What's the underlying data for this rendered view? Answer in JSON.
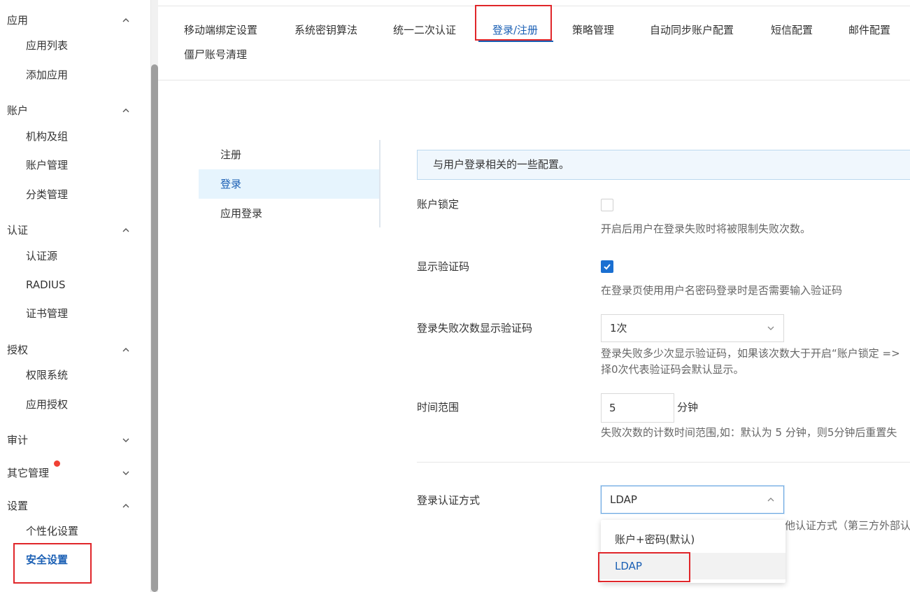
{
  "sidebar": {
    "groups": [
      {
        "label": "应用",
        "expanded": true,
        "items": [
          "应用列表",
          "添加应用"
        ]
      },
      {
        "label": "账户",
        "expanded": true,
        "items": [
          "机构及组",
          "账户管理",
          "分类管理"
        ]
      },
      {
        "label": "认证",
        "expanded": true,
        "items": [
          "认证源",
          "RADIUS",
          "证书管理"
        ]
      },
      {
        "label": "授权",
        "expanded": true,
        "items": [
          "权限系统",
          "应用授权"
        ]
      },
      {
        "label": "审计",
        "expanded": false,
        "items": []
      },
      {
        "label": "其它管理",
        "expanded": false,
        "items": [],
        "badge": "dot"
      },
      {
        "label": "设置",
        "expanded": true,
        "items": [
          "个性化设置",
          "安全设置"
        ]
      }
    ],
    "active_item": "安全设置"
  },
  "tabs": {
    "items": [
      "移动端绑定设置",
      "系统密钥算法",
      "统一二次认证",
      "登录/注册",
      "策略管理",
      "自动同步账户配置",
      "短信配置",
      "邮件配置",
      "僵尸账号清理"
    ],
    "active": "登录/注册"
  },
  "inner_menu": {
    "items": [
      "注册",
      "登录",
      "应用登录"
    ],
    "active": "登录"
  },
  "form": {
    "info": "与用户登录相关的一些配置。",
    "account_lock": {
      "label": "账户锁定",
      "checked": false,
      "help": "开启后用户在登录失败时将被限制失败次数。"
    },
    "show_captcha": {
      "label": "显示验证码",
      "checked": true,
      "help": "在登录页使用用户名密码登录时是否需要输入验证码"
    },
    "fail_count_captcha": {
      "label": "登录失败次数显示验证码",
      "value": "1次",
      "help_line1": "登录失败多少次显示验证码，如果该次数大于开启“账户锁定 =>",
      "help_line2": "择0次代表验证码会默认显示。"
    },
    "time_range": {
      "label": "时间范围",
      "value": "5",
      "unit": "分钟",
      "help": "失败次数的计数时间范围,如：默认为 5 分钟，则5分钟后重置失"
    },
    "login_auth_method": {
      "label": "登录认证方式",
      "value": "LDAP",
      "help_tail": "他认证方式（第三方外部认",
      "options": [
        "账户+密码(默认)",
        "LDAP"
      ],
      "selected": "LDAP"
    }
  },
  "colors": {
    "accent": "#1a5fb4",
    "highlight_box": "#e0262a",
    "badge": "#f04134",
    "info_bg": "#f0f7fd"
  }
}
